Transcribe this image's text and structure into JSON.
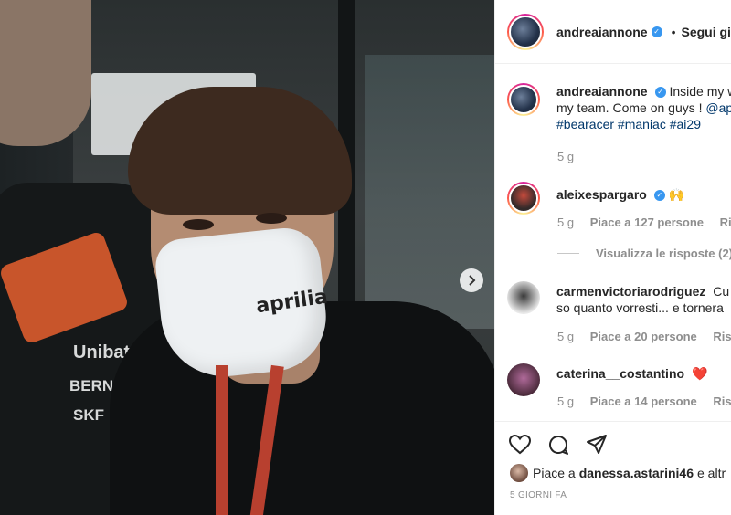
{
  "post": {
    "author": "andreaiannone",
    "follow_sep": "•",
    "follow_label": "Segui già",
    "next_icon": "chevron-right-icon"
  },
  "photo_texts": {
    "mask_brand": "aprilia",
    "sponsor_1": "Unibat",
    "sponsor_2": "BERN",
    "sponsor_3": "SKF"
  },
  "caption": {
    "username": "andreaiannone",
    "line1": "Inside my w",
    "line2_a": "my team. Come on guys ! ",
    "line2_mention": "@ap",
    "hashtags": "#bearacer #maniac #ai29",
    "time": "5 g"
  },
  "comments": [
    {
      "username": "aleixespargaro",
      "text": "🙌",
      "time": "5 g",
      "likes": "Piace a 127 persone",
      "reply": "Rispo",
      "view_replies": "Visualizza le risposte (2)"
    },
    {
      "username": "carmenvictoriarodriguez",
      "text_suffix": "Cu",
      "line2": "so quanto vorresti... e tornera",
      "time": "5 g",
      "likes": "Piace a 20 persone",
      "reply": "Rispon"
    },
    {
      "username": "caterina__costantino",
      "text": "❤️",
      "time": "5 g",
      "likes": "Piace a 14 persone",
      "reply": "Rispon"
    }
  ],
  "likes_bar": {
    "prefix": "Piace a",
    "liker": "danessa.astarini46",
    "suffix": "e altr"
  },
  "date": "5 GIORNI FA"
}
